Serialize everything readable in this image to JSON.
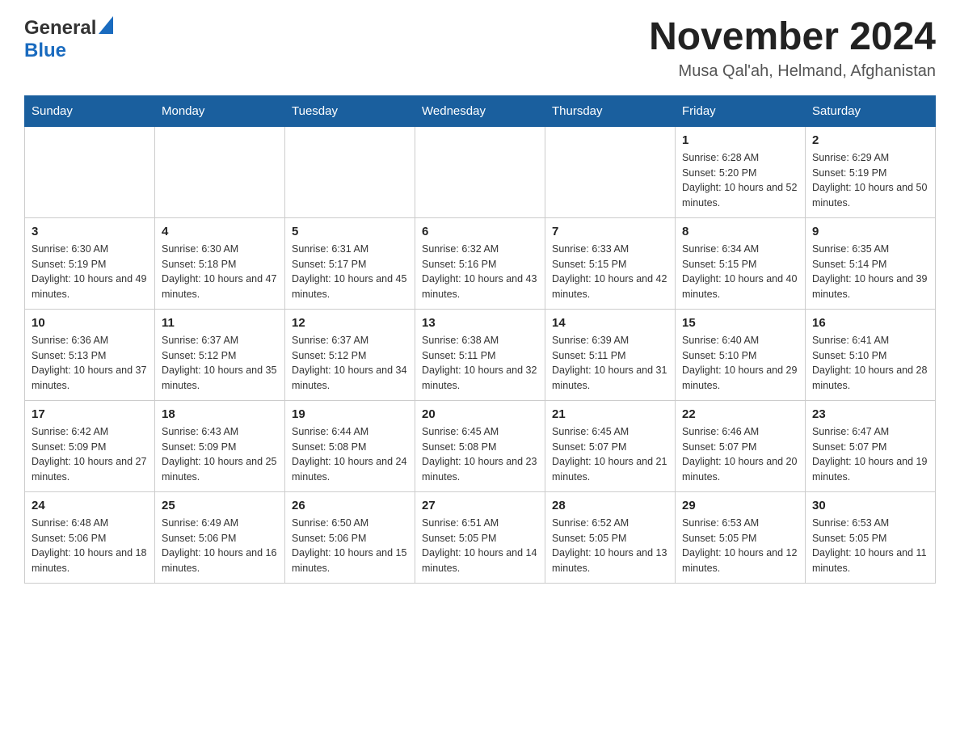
{
  "header": {
    "logo_general": "General",
    "logo_blue": "Blue",
    "title": "November 2024",
    "subtitle": "Musa Qal'ah, Helmand, Afghanistan"
  },
  "days_of_week": [
    "Sunday",
    "Monday",
    "Tuesday",
    "Wednesday",
    "Thursday",
    "Friday",
    "Saturday"
  ],
  "weeks": [
    {
      "days": [
        {
          "num": "",
          "info": ""
        },
        {
          "num": "",
          "info": ""
        },
        {
          "num": "",
          "info": ""
        },
        {
          "num": "",
          "info": ""
        },
        {
          "num": "",
          "info": ""
        },
        {
          "num": "1",
          "info": "Sunrise: 6:28 AM\nSunset: 5:20 PM\nDaylight: 10 hours and 52 minutes."
        },
        {
          "num": "2",
          "info": "Sunrise: 6:29 AM\nSunset: 5:19 PM\nDaylight: 10 hours and 50 minutes."
        }
      ]
    },
    {
      "days": [
        {
          "num": "3",
          "info": "Sunrise: 6:30 AM\nSunset: 5:19 PM\nDaylight: 10 hours and 49 minutes."
        },
        {
          "num": "4",
          "info": "Sunrise: 6:30 AM\nSunset: 5:18 PM\nDaylight: 10 hours and 47 minutes."
        },
        {
          "num": "5",
          "info": "Sunrise: 6:31 AM\nSunset: 5:17 PM\nDaylight: 10 hours and 45 minutes."
        },
        {
          "num": "6",
          "info": "Sunrise: 6:32 AM\nSunset: 5:16 PM\nDaylight: 10 hours and 43 minutes."
        },
        {
          "num": "7",
          "info": "Sunrise: 6:33 AM\nSunset: 5:15 PM\nDaylight: 10 hours and 42 minutes."
        },
        {
          "num": "8",
          "info": "Sunrise: 6:34 AM\nSunset: 5:15 PM\nDaylight: 10 hours and 40 minutes."
        },
        {
          "num": "9",
          "info": "Sunrise: 6:35 AM\nSunset: 5:14 PM\nDaylight: 10 hours and 39 minutes."
        }
      ]
    },
    {
      "days": [
        {
          "num": "10",
          "info": "Sunrise: 6:36 AM\nSunset: 5:13 PM\nDaylight: 10 hours and 37 minutes."
        },
        {
          "num": "11",
          "info": "Sunrise: 6:37 AM\nSunset: 5:12 PM\nDaylight: 10 hours and 35 minutes."
        },
        {
          "num": "12",
          "info": "Sunrise: 6:37 AM\nSunset: 5:12 PM\nDaylight: 10 hours and 34 minutes."
        },
        {
          "num": "13",
          "info": "Sunrise: 6:38 AM\nSunset: 5:11 PM\nDaylight: 10 hours and 32 minutes."
        },
        {
          "num": "14",
          "info": "Sunrise: 6:39 AM\nSunset: 5:11 PM\nDaylight: 10 hours and 31 minutes."
        },
        {
          "num": "15",
          "info": "Sunrise: 6:40 AM\nSunset: 5:10 PM\nDaylight: 10 hours and 29 minutes."
        },
        {
          "num": "16",
          "info": "Sunrise: 6:41 AM\nSunset: 5:10 PM\nDaylight: 10 hours and 28 minutes."
        }
      ]
    },
    {
      "days": [
        {
          "num": "17",
          "info": "Sunrise: 6:42 AM\nSunset: 5:09 PM\nDaylight: 10 hours and 27 minutes."
        },
        {
          "num": "18",
          "info": "Sunrise: 6:43 AM\nSunset: 5:09 PM\nDaylight: 10 hours and 25 minutes."
        },
        {
          "num": "19",
          "info": "Sunrise: 6:44 AM\nSunset: 5:08 PM\nDaylight: 10 hours and 24 minutes."
        },
        {
          "num": "20",
          "info": "Sunrise: 6:45 AM\nSunset: 5:08 PM\nDaylight: 10 hours and 23 minutes."
        },
        {
          "num": "21",
          "info": "Sunrise: 6:45 AM\nSunset: 5:07 PM\nDaylight: 10 hours and 21 minutes."
        },
        {
          "num": "22",
          "info": "Sunrise: 6:46 AM\nSunset: 5:07 PM\nDaylight: 10 hours and 20 minutes."
        },
        {
          "num": "23",
          "info": "Sunrise: 6:47 AM\nSunset: 5:07 PM\nDaylight: 10 hours and 19 minutes."
        }
      ]
    },
    {
      "days": [
        {
          "num": "24",
          "info": "Sunrise: 6:48 AM\nSunset: 5:06 PM\nDaylight: 10 hours and 18 minutes."
        },
        {
          "num": "25",
          "info": "Sunrise: 6:49 AM\nSunset: 5:06 PM\nDaylight: 10 hours and 16 minutes."
        },
        {
          "num": "26",
          "info": "Sunrise: 6:50 AM\nSunset: 5:06 PM\nDaylight: 10 hours and 15 minutes."
        },
        {
          "num": "27",
          "info": "Sunrise: 6:51 AM\nSunset: 5:05 PM\nDaylight: 10 hours and 14 minutes."
        },
        {
          "num": "28",
          "info": "Sunrise: 6:52 AM\nSunset: 5:05 PM\nDaylight: 10 hours and 13 minutes."
        },
        {
          "num": "29",
          "info": "Sunrise: 6:53 AM\nSunset: 5:05 PM\nDaylight: 10 hours and 12 minutes."
        },
        {
          "num": "30",
          "info": "Sunrise: 6:53 AM\nSunset: 5:05 PM\nDaylight: 10 hours and 11 minutes."
        }
      ]
    }
  ]
}
